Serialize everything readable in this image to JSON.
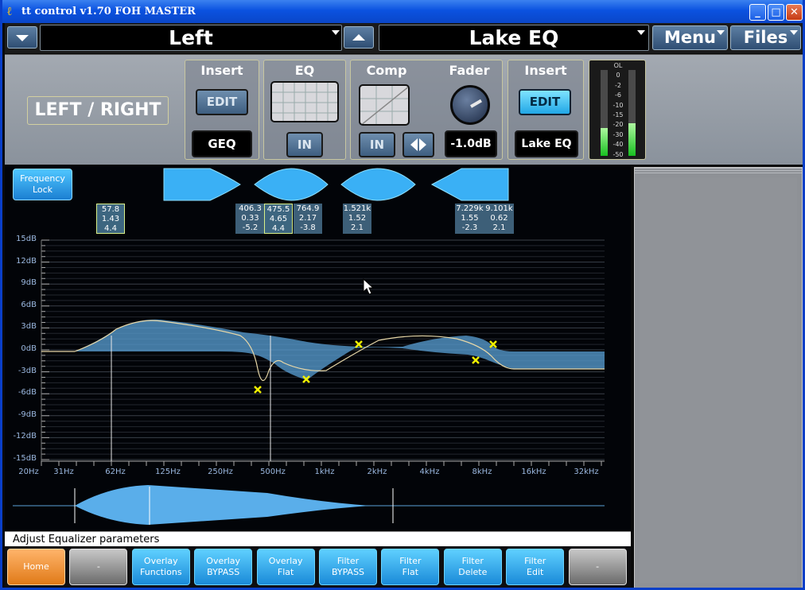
{
  "window": {
    "title": "tt control  v1.70 FOH MASTER",
    "min": "_",
    "max": "□",
    "close": "✕"
  },
  "topbar": {
    "channel": "Left",
    "module": "Lake EQ",
    "menu": "Menu",
    "files": "Files"
  },
  "panel": {
    "channel_name": "LEFT / RIGHT",
    "insert1": {
      "label": "Insert",
      "edit": "EDIT",
      "value": "GEQ"
    },
    "eq": {
      "label": "EQ",
      "in": "IN"
    },
    "comp": {
      "label": "Comp",
      "in": "IN"
    },
    "fader": {
      "label": "Fader",
      "value": "-1.0dB"
    },
    "insert2": {
      "label": "Insert",
      "edit": "EDIT",
      "value": "Lake EQ"
    },
    "meter": {
      "labels": [
        "OL",
        "0",
        "-2",
        "-6",
        "-10",
        "-15",
        "-20",
        "-30",
        "-40",
        "-50"
      ],
      "levels": [
        0.32,
        0.38
      ]
    }
  },
  "eq": {
    "frequency_lock": "Frequency Lock",
    "bands": [
      {
        "f": "57.8",
        "q": "1.43",
        "g": "4.4",
        "sel": true
      },
      {
        "f": "406.3",
        "q": "0.33",
        "g": "-5.2",
        "sel": false
      },
      {
        "f": "475.5",
        "q": "4.65",
        "g": "4.4",
        "sel": true
      },
      {
        "f": "764.9",
        "q": "2.17",
        "g": "-3.8",
        "sel": false
      },
      {
        "f": "1.521k",
        "q": "1.52",
        "g": "2.1",
        "sel": false
      },
      {
        "f": "7.229k",
        "q": "1.55",
        "g": "-2.3",
        "sel": false
      },
      {
        "f": "9.101k",
        "q": "0.62",
        "g": "2.1",
        "sel": false
      }
    ],
    "ylabels": [
      "15dB",
      "12dB",
      "9dB",
      "6dB",
      "3dB",
      "0dB",
      "-3dB",
      "-6dB",
      "-9dB",
      "-12dB",
      "-15dB"
    ],
    "xlabels": [
      "20Hz",
      "31Hz",
      "62Hz",
      "125Hz",
      "250Hz",
      "500Hz",
      "1kHz",
      "2kHz",
      "4kHz",
      "8kHz",
      "16kHz",
      "32kHz"
    ]
  },
  "status": "Adjust Equalizer parameters",
  "buttons": [
    "Home",
    "-",
    "Overlay\nFunctions",
    "Overlay\nBYPASS",
    "Overlay\nFlat",
    "Filter\nBYPASS",
    "Filter\nFlat",
    "Filter\nDelete",
    "Filter\nEdit",
    "-"
  ]
}
